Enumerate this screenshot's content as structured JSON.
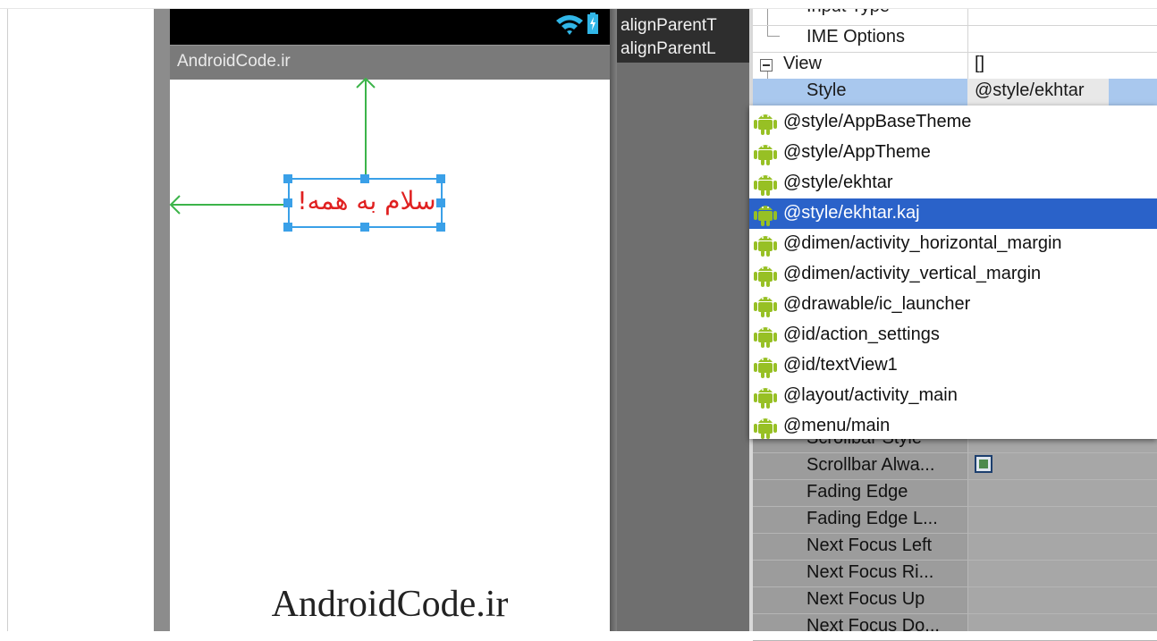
{
  "device": {
    "action_bar_title": "AndroidCode.ir",
    "text_view": "سلام به همه!",
    "watermark": "AndroidCode.ir"
  },
  "tooltip": {
    "line1": "alignParentT",
    "line2": "alignParentL"
  },
  "properties": {
    "input_type": "Input Type",
    "ime_options": "IME Options",
    "view_group": "View",
    "view_value": "[]",
    "style_name": "Style",
    "style_value": "@style/ekhtar"
  },
  "dropdown": {
    "items": [
      "@style/AppBaseTheme",
      "@style/AppTheme",
      "@style/ekhtar",
      "@style/ekhtar.kaj",
      "@dimen/activity_horizontal_margin",
      "@dimen/activity_vertical_margin",
      "@drawable/ic_launcher",
      "@id/action_settings",
      "@id/textView1",
      "@layout/activity_main",
      "@menu/main"
    ],
    "selected_index": 3
  },
  "lower_properties": {
    "items": [
      "Scrollbar Style",
      "Scrollbar Alwa...",
      "Fading Edge",
      "Fading Edge L...",
      "Next Focus Left",
      "Next Focus Ri...",
      "Next Focus Up",
      "Next Focus Do..."
    ]
  },
  "colors": {
    "selection": "#2a62c9",
    "text_red": "#e02020",
    "guide_green": "#3cb44a",
    "handle_blue": "#3aa0e8",
    "android_green": "#97c024"
  },
  "icons": [
    "wifi-icon",
    "battery-icon",
    "collapse-minus-icon",
    "android-icon",
    "checkbox-icon"
  ]
}
